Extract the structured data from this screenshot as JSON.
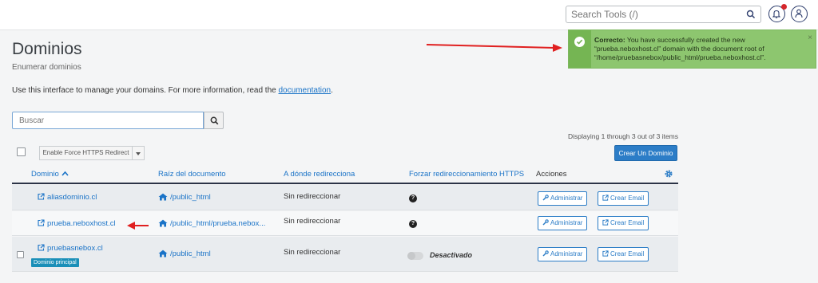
{
  "header": {
    "search_placeholder": "Search Tools (/)"
  },
  "page": {
    "title": "Dominios",
    "subtitle": "Enumerar dominios",
    "intro_text": "Use this interface to manage your domains. For more information, read the ",
    "intro_link": "documentation",
    "intro_end": "."
  },
  "alert": {
    "strong": "Correcto:",
    "message": " You have successfully created the new “prueba.neboxhost.cl” domain with the document root of “/home/pruebasnebox/public_html/prueba.neboxhost.cl”.",
    "close": "×"
  },
  "search": {
    "placeholder": "Buscar"
  },
  "toolbar": {
    "force_https_label": "Enable Force HTTPS Redirect",
    "displaying": "Displaying 1 through 3 out of 3 items",
    "create_button": "Crear Un Dominio"
  },
  "table": {
    "columns": {
      "domain": "Dominio",
      "docroot": "Raíz del documento",
      "redirect": "A dónde redirecciona",
      "force_https": "Forzar redireccionamiento HTTPS",
      "actions": "Acciones"
    },
    "rows": [
      {
        "domain": "aliasdominio.cl",
        "docroot": "/public_html",
        "redirect": "Sin redireccionar",
        "https": "?",
        "manage": "Administrar",
        "email": "Crear Email"
      },
      {
        "domain": "prueba.neboxhost.cl",
        "docroot": "/public_html/prueba.nebox...",
        "redirect": "Sin redireccionar",
        "https": "?",
        "manage": "Administrar",
        "email": "Crear Email"
      },
      {
        "domain": "pruebasnebox.cl",
        "docroot": "/public_html",
        "redirect": "Sin redireccionar",
        "https_status": "Desactivado",
        "badge": "Dominio principal",
        "manage": "Administrar",
        "email": "Crear Email"
      }
    ]
  },
  "colors": {
    "accent": "#2c7dc7",
    "link": "#1a73c7",
    "success": "#8dc66f",
    "annotation_arrow": "#e02020"
  }
}
